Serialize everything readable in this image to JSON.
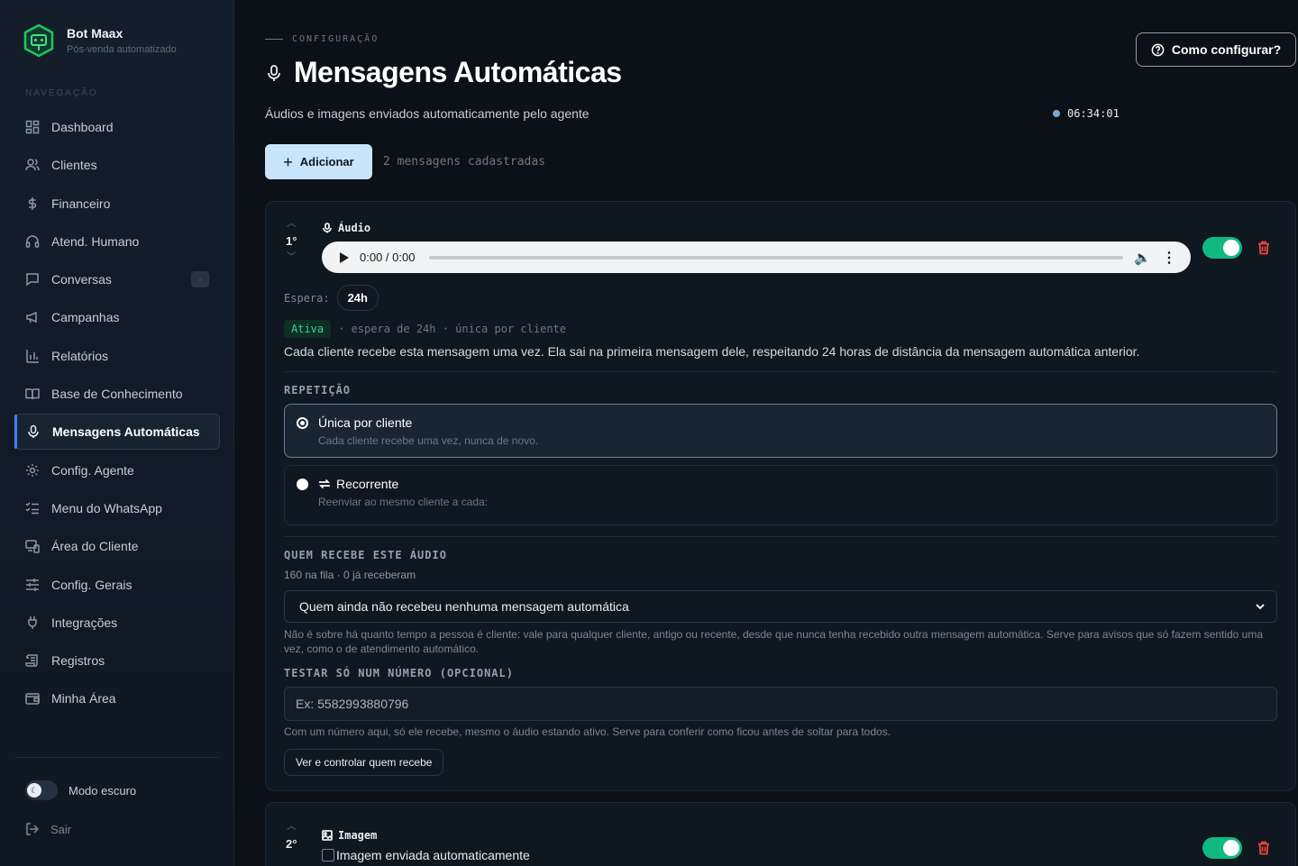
{
  "brand": {
    "name": "Bot Maax",
    "subtitle": "Pós-venda automatizado"
  },
  "nav_section": "NAVEGAÇÃO",
  "nav": [
    {
      "label": "Dashboard",
      "icon": "dashboard-icon"
    },
    {
      "label": "Clientes",
      "icon": "users-icon"
    },
    {
      "label": "Financeiro",
      "icon": "dollar-icon"
    },
    {
      "label": "Atend. Humano",
      "icon": "headset-icon"
    },
    {
      "label": "Conversas",
      "icon": "chat-icon",
      "badge": "·"
    },
    {
      "label": "Campanhas",
      "icon": "megaphone-icon"
    },
    {
      "label": "Relatórios",
      "icon": "bar-chart-icon"
    },
    {
      "label": "Base de Conhecimento",
      "icon": "book-icon"
    },
    {
      "label": "Mensagens Automáticas",
      "icon": "mic-icon",
      "active": true
    },
    {
      "label": "Config. Agente",
      "icon": "gear-icon"
    },
    {
      "label": "Menu do WhatsApp",
      "icon": "list-icon"
    },
    {
      "label": "Área do Cliente",
      "icon": "devices-icon"
    },
    {
      "label": "Config. Gerais",
      "icon": "sliders-icon"
    },
    {
      "label": "Integrações",
      "icon": "plug-icon"
    },
    {
      "label": "Registros",
      "icon": "scroll-icon"
    },
    {
      "label": "Minha Área",
      "icon": "wallet-icon"
    }
  ],
  "dark_mode_label": "Modo escuro",
  "logout_label": "Sair",
  "header": {
    "eyebrow": "CONFIGURAÇÃO",
    "title": "Mensagens Automáticas",
    "subtitle": "Áudios e imagens enviados automaticamente pelo agente",
    "clock": "06:34:01",
    "howto_label": "Como configurar?"
  },
  "toolbar": {
    "add_label": "Adicionar",
    "count_text": "2 mensagens cadastradas"
  },
  "message1": {
    "order": "1°",
    "type_label": "Áudio",
    "audio_time": "0:00 / 0:00",
    "enabled": true,
    "wait_label": "Espera:",
    "wait_value": "24h",
    "status_badge": "Ativa",
    "status_meta": "· espera de 24h · única por cliente",
    "description": "Cada cliente recebe esta mensagem uma vez. Ela sai na primeira mensagem dele, respeitando 24 horas de distância da mensagem automática anterior.",
    "repetition_label": "REPETIÇÃO",
    "option_unique_title": "Única por cliente",
    "option_unique_sub": "Cada cliente recebe uma vez, nunca de novo.",
    "option_recurring_title": "Recorrente",
    "option_recurring_sub": "Reenviar ao mesmo cliente a cada:",
    "audience_label": "QUEM RECEBE ESTE ÁUDIO",
    "queue_info": "160 na fila · 0 já receberam",
    "audience_select": "Quem ainda não recebeu nenhuma mensagem automática",
    "audience_help": "Não é sobre há quanto tempo a pessoa é cliente: vale para qualquer cliente, antigo ou recente, desde que nunca tenha recebido outra mensagem automática. Serve para avisos que só fazem sentido uma vez, como o de atendimento automático.",
    "test_label": "TESTAR SÓ NUM NÚMERO (OPCIONAL)",
    "test_placeholder": "Ex: 5582993880796",
    "test_help": "Com um número aqui, só ele recebe, mesmo o áudio estando ativo. Serve para conferir como ficou antes de soltar para todos.",
    "control_button": "Ver e controlar quem recebe"
  },
  "message2": {
    "order": "2°",
    "type_label": "Imagem",
    "image_alt": "Imagem enviada automaticamente",
    "enabled": true
  },
  "colors": {
    "accent_green": "#10b981",
    "danger": "#ef4444",
    "primary_btn": "#c8e6fb",
    "background": "#0b1117"
  }
}
